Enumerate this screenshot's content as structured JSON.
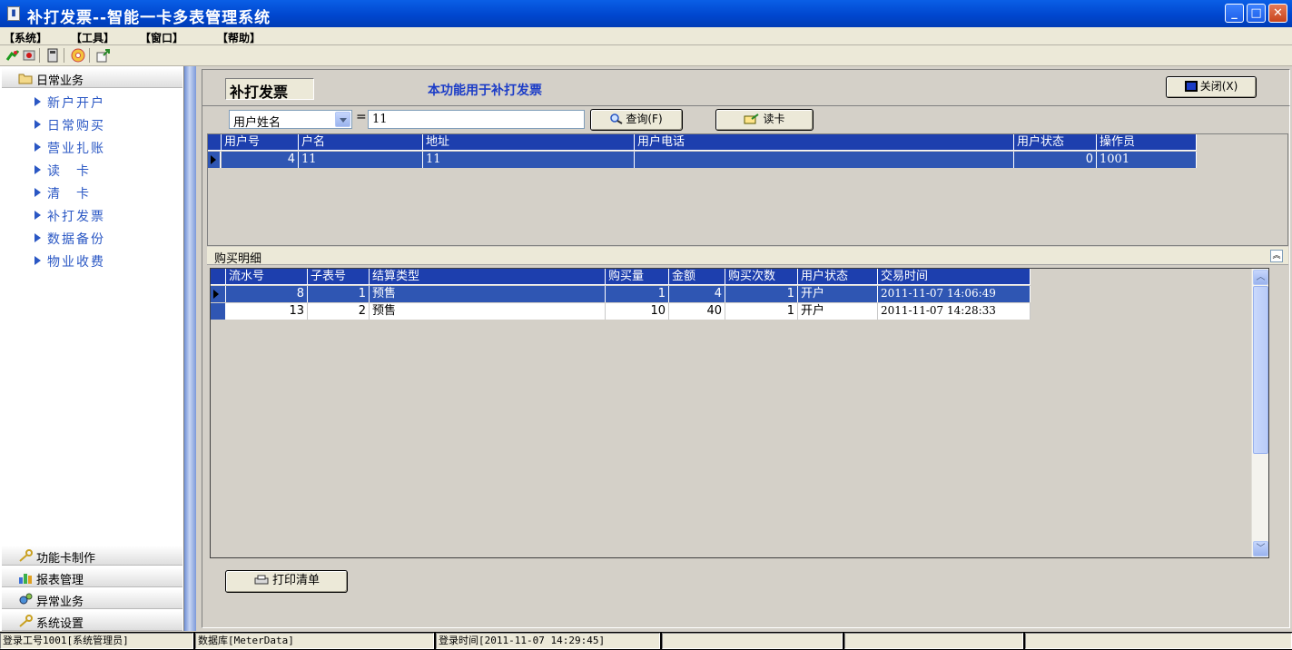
{
  "window": {
    "title": "补打发票--智能一卡多表管理系统",
    "app_icon": "document-icon"
  },
  "menu": [
    "【系统】",
    "【工具】",
    "【窗口】",
    "【帮助】"
  ],
  "toolbar_icons": [
    "run-icon",
    "stop-icon",
    "calculator-icon",
    "cd-icon",
    "export-icon"
  ],
  "sidebar": {
    "groups": [
      {
        "label": "日常业务",
        "icon": "folder-icon"
      },
      {
        "label": "功能卡制作",
        "icon": "key-icon"
      },
      {
        "label": "报表管理",
        "icon": "chart-icon"
      },
      {
        "label": "异常业务",
        "icon": "gear-icon"
      },
      {
        "label": "系统设置",
        "icon": "key-icon"
      }
    ],
    "items": [
      "新户开户",
      "日常购买",
      "营业扎账",
      "读　卡",
      "清　卡",
      "补打发票",
      "数据备份",
      "物业收费"
    ]
  },
  "header": {
    "title": "补打发票",
    "description": "本功能用于补打发票",
    "close_label": "关闭(X)"
  },
  "search": {
    "field": "用户姓名",
    "operator": "=",
    "value": "11",
    "query_label": "查询(F)",
    "readcard_label": "读卡"
  },
  "users": {
    "columns": [
      "用户号",
      "户名",
      "地址",
      "用户电话",
      "用户状态",
      "操作员"
    ],
    "rows": [
      [
        "4",
        "11",
        "11",
        "",
        "0",
        "1001"
      ]
    ]
  },
  "detail": {
    "title": "购买明细",
    "columns": [
      "流水号",
      "子表号",
      "结算类型",
      "购买量",
      "金额",
      "购买次数",
      "用户状态",
      "交易时间"
    ],
    "rows": [
      [
        "8",
        "1",
        "预售",
        "1",
        "4",
        "1",
        "开户",
        "2011-11-07 14:06:49"
      ],
      [
        "13",
        "2",
        "预售",
        "10",
        "40",
        "1",
        "开户",
        "2011-11-07 14:28:33"
      ]
    ],
    "print_label": "打印清单"
  },
  "status": {
    "login": "登录工号1001[系统管理员]",
    "database": "数据库[MeterData]",
    "time": "登录时间[2011-11-07 14:29:45]"
  },
  "colors": {
    "titlebar": "#0047cf",
    "selection": "#2f56b3",
    "header": "#1d3fae",
    "link": "#2a57c4"
  }
}
